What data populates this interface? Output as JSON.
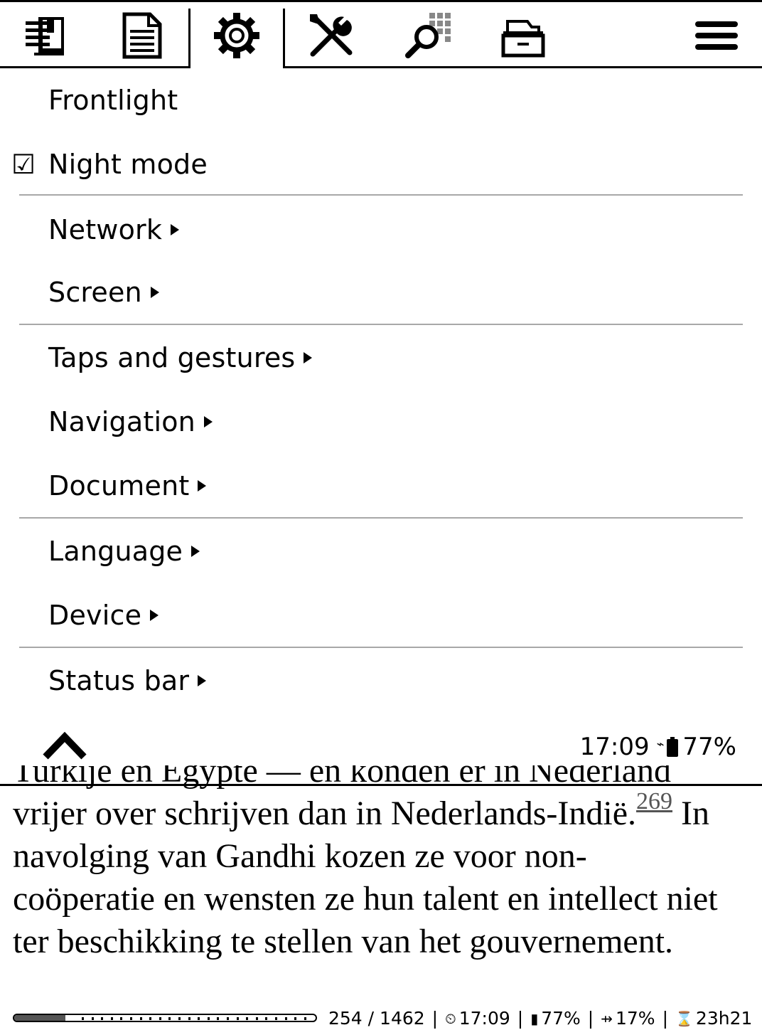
{
  "tabs": [
    {
      "icon": "book-navigation-icon",
      "active": false
    },
    {
      "icon": "document-page-icon",
      "active": false
    },
    {
      "icon": "gear-icon",
      "active": true
    },
    {
      "icon": "tools-icon",
      "active": false
    },
    {
      "icon": "search-icon",
      "active": false
    },
    {
      "icon": "file-cabinet-icon",
      "active": false
    },
    {
      "icon": "hamburger-menu-icon",
      "active": false
    }
  ],
  "menu": {
    "items": [
      {
        "label": "Frontlight",
        "submenu": false,
        "checked": false
      },
      {
        "label": "Night mode",
        "submenu": false,
        "checked": true,
        "check_glyph": "☑"
      },
      {
        "label": "Network",
        "submenu": true
      },
      {
        "label": "Screen",
        "submenu": true
      },
      {
        "label": "Taps and gestures",
        "submenu": true
      },
      {
        "label": "Navigation",
        "submenu": true
      },
      {
        "label": "Document",
        "submenu": true
      },
      {
        "label": "Language",
        "submenu": true
      },
      {
        "label": "Device",
        "submenu": true
      },
      {
        "label": "Status bar",
        "submenu": true
      }
    ],
    "footer": {
      "time": "17:09",
      "battery": "77%",
      "charging_glyph": "⌁"
    }
  },
  "book": {
    "cut_line": "Turkije en Egypte — en konden er in Nederland",
    "line1_text": "vrijer over schrijven dan in Nederlands-Indië.",
    "footnote": "269",
    "line1_after": " In",
    "line2": "navolging van Gandhi kozen ze voor non-",
    "line3": "coöperatie en wensten ze hun talent en intellect niet",
    "line4": "ter beschikking te stellen van het gouvernement."
  },
  "status_bar": {
    "progress_fraction": 0.17,
    "pages": "254 / 1462",
    "clock_glyph": "⏲",
    "time": "17:09",
    "battery_glyph": "▮",
    "battery": "77%",
    "progress_glyph": "⇸",
    "percent_read": "17%",
    "hourglass_glyph": "⌛",
    "time_left": "23h21",
    "separator": "|"
  }
}
